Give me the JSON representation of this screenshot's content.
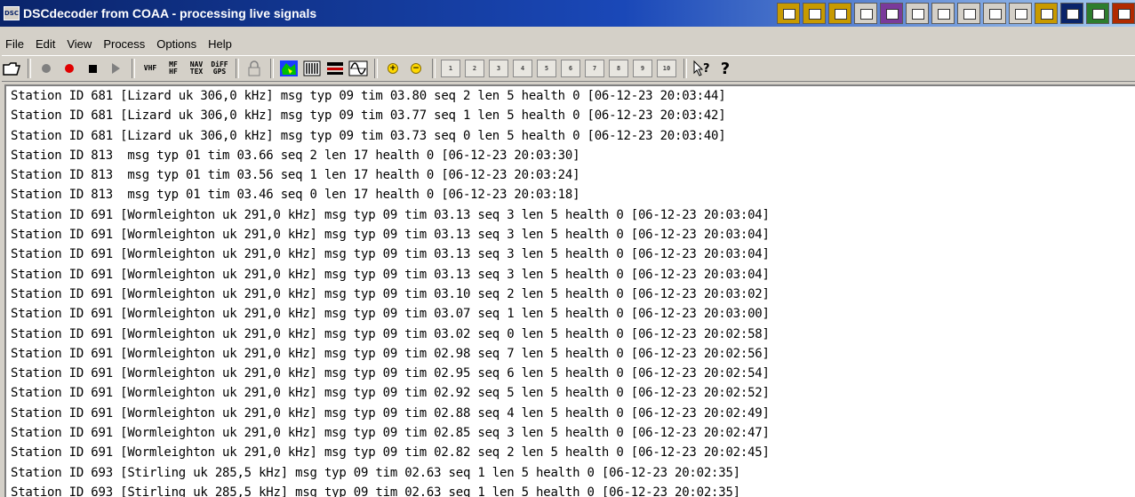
{
  "window": {
    "icon_text": "DSC",
    "title": "DSCdecoder from COAA - processing live signals"
  },
  "menu": [
    "File",
    "Edit",
    "View",
    "Process",
    "Options",
    "Help"
  ],
  "toolbar": {
    "vhf": "VHF",
    "mf_hf": "MF HF",
    "nav_tex": "NAV TEX",
    "diff_gps": "DiFF GPS",
    "plus": "+",
    "minus": "−",
    "signal_buttons": [
      "1",
      "2",
      "3",
      "4",
      "5",
      "6",
      "7",
      "8",
      "9",
      "10"
    ]
  },
  "log_lines": [
    "Station ID 681 [Lizard uk 306,0 kHz] msg typ 09 tim 03.80 seq 2 len 5 health 0 [06-12-23 20:03:44]",
    "Station ID 681 [Lizard uk 306,0 kHz] msg typ 09 tim 03.77 seq 1 len 5 health 0 [06-12-23 20:03:42]",
    "Station ID 681 [Lizard uk 306,0 kHz] msg typ 09 tim 03.73 seq 0 len 5 health 0 [06-12-23 20:03:40]",
    "Station ID 813  msg typ 01 tim 03.66 seq 2 len 17 health 0 [06-12-23 20:03:30]",
    "Station ID 813  msg typ 01 tim 03.56 seq 1 len 17 health 0 [06-12-23 20:03:24]",
    "Station ID 813  msg typ 01 tim 03.46 seq 0 len 17 health 0 [06-12-23 20:03:18]",
    "Station ID 691 [Wormleighton uk 291,0 kHz] msg typ 09 tim 03.13 seq 3 len 5 health 0 [06-12-23 20:03:04]",
    "Station ID 691 [Wormleighton uk 291,0 kHz] msg typ 09 tim 03.13 seq 3 len 5 health 0 [06-12-23 20:03:04]",
    "Station ID 691 [Wormleighton uk 291,0 kHz] msg typ 09 tim 03.13 seq 3 len 5 health 0 [06-12-23 20:03:04]",
    "Station ID 691 [Wormleighton uk 291,0 kHz] msg typ 09 tim 03.13 seq 3 len 5 health 0 [06-12-23 20:03:04]",
    "Station ID 691 [Wormleighton uk 291,0 kHz] msg typ 09 tim 03.10 seq 2 len 5 health 0 [06-12-23 20:03:02]",
    "Station ID 691 [Wormleighton uk 291,0 kHz] msg typ 09 tim 03.07 seq 1 len 5 health 0 [06-12-23 20:03:00]",
    "Station ID 691 [Wormleighton uk 291,0 kHz] msg typ 09 tim 03.02 seq 0 len 5 health 0 [06-12-23 20:02:58]",
    "Station ID 691 [Wormleighton uk 291,0 kHz] msg typ 09 tim 02.98 seq 7 len 5 health 0 [06-12-23 20:02:56]",
    "Station ID 691 [Wormleighton uk 291,0 kHz] msg typ 09 tim 02.95 seq 6 len 5 health 0 [06-12-23 20:02:54]",
    "Station ID 691 [Wormleighton uk 291,0 kHz] msg typ 09 tim 02.92 seq 5 len 5 health 0 [06-12-23 20:02:52]",
    "Station ID 691 [Wormleighton uk 291,0 kHz] msg typ 09 tim 02.88 seq 4 len 5 health 0 [06-12-23 20:02:49]",
    "Station ID 691 [Wormleighton uk 291,0 kHz] msg typ 09 tim 02.85 seq 3 len 5 health 0 [06-12-23 20:02:47]",
    "Station ID 691 [Wormleighton uk 291,0 kHz] msg typ 09 tim 02.82 seq 2 len 5 health 0 [06-12-23 20:02:45]",
    "Station ID 693 [Stirling uk 285,5 kHz] msg typ 09 tim 02.63 seq 1 len 5 health 0 [06-12-23 20:02:35]",
    "Station ID 693 [Stirling uk 285,5 kHz] msg typ 09 tim 02.63 seq 1 len 5 health 0 [06-12-23 20:02:35]"
  ]
}
